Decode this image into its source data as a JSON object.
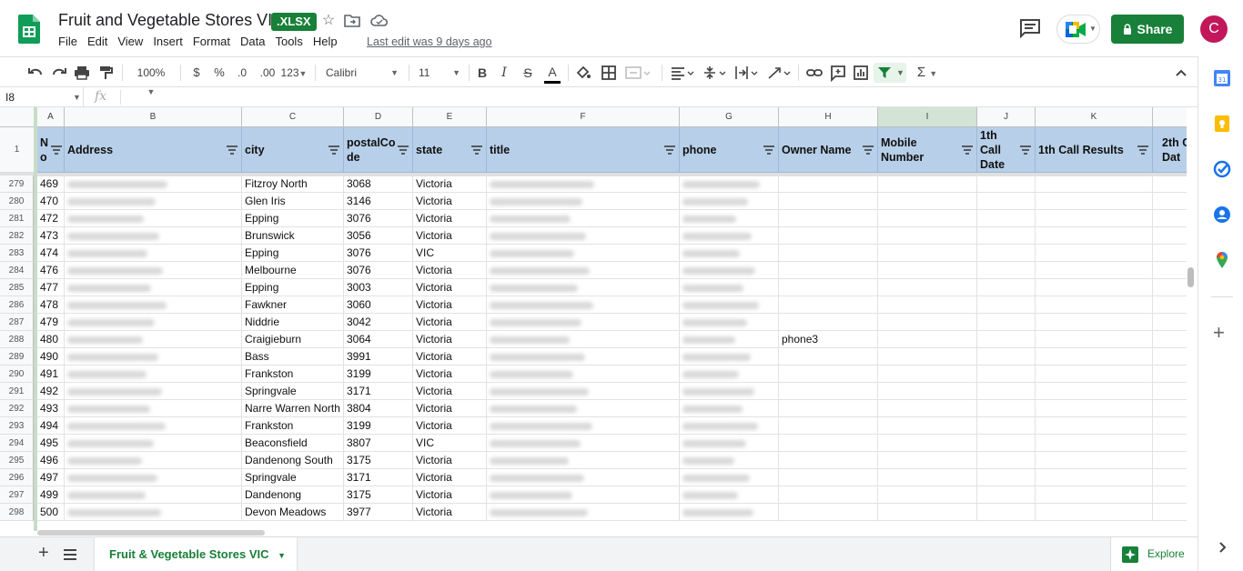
{
  "app": {
    "doc_title": "Fruit and Vegetable Stores VIC",
    "format_badge": ".XLSX",
    "last_edit": "Last edit was 9 days ago",
    "share_label": "Share",
    "avatar_letter": "C"
  },
  "menu": [
    "File",
    "Edit",
    "View",
    "Insert",
    "Format",
    "Data",
    "Tools",
    "Help"
  ],
  "toolbar": {
    "zoom": "100%",
    "currency": "$",
    "percent": "%",
    "dec_decrease": ".0",
    "dec_increase": ".00",
    "number_format": "123",
    "font": "Calibri",
    "font_size": "11",
    "bold": "B",
    "italic": "I",
    "strike": "S",
    "text_color": "A",
    "sigma": "Σ"
  },
  "formula_bar": {
    "cell_ref": "I8",
    "fx": "fx"
  },
  "columns": [
    "A",
    "B",
    "C",
    "D",
    "E",
    "F",
    "G",
    "H",
    "I",
    "J",
    "K"
  ],
  "header_row_number": "1",
  "headers": {
    "A": "N o",
    "B": "Address",
    "C": "city",
    "D": "postalCo de",
    "E": "state",
    "F": "title",
    "G": "phone",
    "H": "Owner Name",
    "I": "Mobile Number",
    "J": "1th Call Date",
    "K": "1th Call Results",
    "L": "2th C Dat"
  },
  "rows": [
    {
      "num": "279",
      "no": "469",
      "city": "Fitzroy North",
      "postal": "3068",
      "state": "Victoria",
      "owner": ""
    },
    {
      "num": "280",
      "no": "470",
      "city": "Glen Iris",
      "postal": "3146",
      "state": "Victoria",
      "owner": ""
    },
    {
      "num": "281",
      "no": "472",
      "city": "Epping",
      "postal": "3076",
      "state": "Victoria",
      "owner": ""
    },
    {
      "num": "282",
      "no": "473",
      "city": "Brunswick",
      "postal": "3056",
      "state": "Victoria",
      "owner": ""
    },
    {
      "num": "283",
      "no": "474",
      "city": "Epping",
      "postal": "3076",
      "state": "VIC",
      "owner": ""
    },
    {
      "num": "284",
      "no": "476",
      "city": "Melbourne",
      "postal": "3076",
      "state": "Victoria",
      "owner": ""
    },
    {
      "num": "285",
      "no": "477",
      "city": "Epping",
      "postal": "3003",
      "state": "Victoria",
      "owner": ""
    },
    {
      "num": "286",
      "no": "478",
      "city": "Fawkner",
      "postal": "3060",
      "state": "Victoria",
      "owner": ""
    },
    {
      "num": "287",
      "no": "479",
      "city": "Niddrie",
      "postal": "3042",
      "state": "Victoria",
      "owner": ""
    },
    {
      "num": "288",
      "no": "480",
      "city": "Craigieburn",
      "postal": "3064",
      "state": "Victoria",
      "owner": "phone3"
    },
    {
      "num": "289",
      "no": "490",
      "city": "Bass",
      "postal": "3991",
      "state": "Victoria",
      "owner": ""
    },
    {
      "num": "290",
      "no": "491",
      "city": "Frankston",
      "postal": "3199",
      "state": "Victoria",
      "owner": ""
    },
    {
      "num": "291",
      "no": "492",
      "city": "Springvale",
      "postal": "3171",
      "state": "Victoria",
      "owner": ""
    },
    {
      "num": "292",
      "no": "493",
      "city": "Narre Warren North",
      "postal": "3804",
      "state": "Victoria",
      "owner": ""
    },
    {
      "num": "293",
      "no": "494",
      "city": "Frankston",
      "postal": "3199",
      "state": "Victoria",
      "owner": ""
    },
    {
      "num": "294",
      "no": "495",
      "city": "Beaconsfield",
      "postal": "3807",
      "state": "VIC",
      "owner": ""
    },
    {
      "num": "295",
      "no": "496",
      "city": "Dandenong South",
      "postal": "3175",
      "state": "Victoria",
      "owner": ""
    },
    {
      "num": "296",
      "no": "497",
      "city": "Springvale",
      "postal": "3171",
      "state": "Victoria",
      "owner": ""
    },
    {
      "num": "297",
      "no": "499",
      "city": "Dandenong",
      "postal": "3175",
      "state": "Victoria",
      "owner": ""
    },
    {
      "num": "298",
      "no": "500",
      "city": "Devon Meadows",
      "postal": "3977",
      "state": "Victoria",
      "owner": ""
    }
  ],
  "sheet_tab": "Fruit & Vegetable Stores VIC",
  "explore_label": "Explore",
  "colors": {
    "accent_green": "#188038",
    "header_fill": "#b7cfe8",
    "avatar": "#c2185b"
  },
  "icons": {
    "logo": "sheets-logo-icon",
    "star": "star-icon",
    "move": "move-to-folder-icon",
    "cloud": "cloud-status-icon"
  }
}
